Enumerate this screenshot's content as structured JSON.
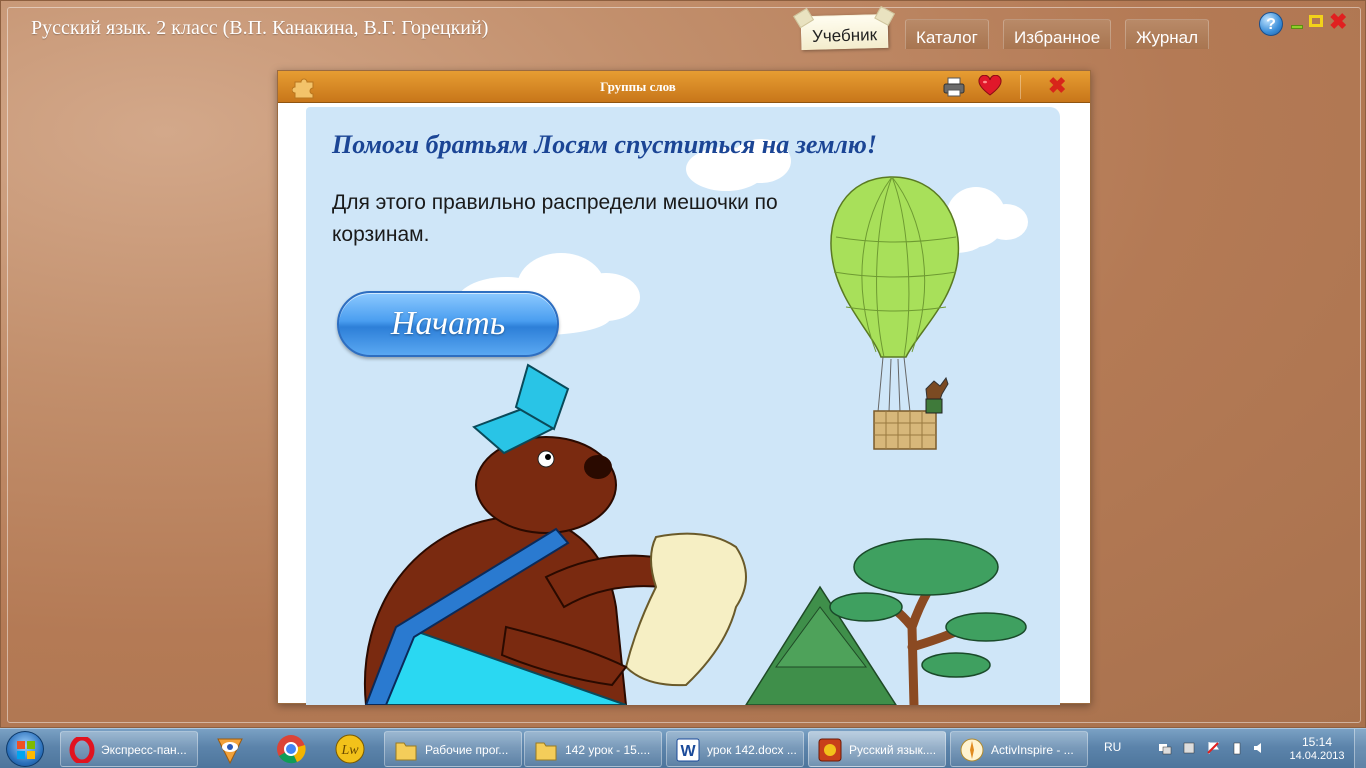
{
  "app": {
    "title": "Русский язык. 2 класс (В.П. Канакина, В.Г. Горецкий)",
    "tabs": [
      {
        "label": "Учебник",
        "active": true
      },
      {
        "label": "Каталог",
        "active": false
      },
      {
        "label": "Избранное",
        "active": false
      },
      {
        "label": "Журнал",
        "active": false
      }
    ],
    "window_controls": {
      "help": "?"
    }
  },
  "dialog": {
    "title": "Группы слов",
    "icons": [
      "puzzle-icon",
      "print-icon",
      "heart-icon",
      "close-icon"
    ],
    "headline": "Помоги братьям Лосям спуститься на землю!",
    "instruction": "Для этого правильно распредели мешочки по корзинам.",
    "start_button": "Начать"
  },
  "taskbar": {
    "buttons": [
      {
        "label": "Экспресс-пан...",
        "icon": "opera-icon"
      },
      {
        "label": "Рабочие прог...",
        "icon": "folder-icon"
      },
      {
        "label": "142 урок - 15....",
        "icon": "folder-icon"
      },
      {
        "label": "урок 142.docx ...",
        "icon": "word-icon"
      },
      {
        "label": "Русский язык....",
        "icon": "app-icon"
      },
      {
        "label": "ActivInspire - ...",
        "icon": "activinspire-icon"
      }
    ],
    "pinned": [
      "eye-icon",
      "chrome-icon",
      "lw-icon"
    ],
    "tray": {
      "language": "RU",
      "time": "15:14",
      "date": "14.04.2013"
    }
  },
  "colors": {
    "header_orange": "#d88a26",
    "headline_blue": "#1b4595",
    "button_blue": "#4a9ef0",
    "sky": "#cfe6f8"
  }
}
